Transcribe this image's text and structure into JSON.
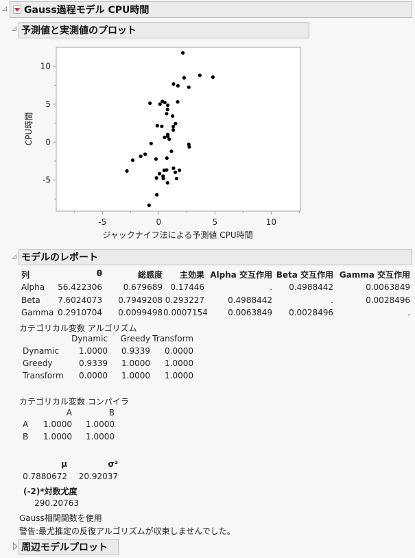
{
  "main_header": {
    "title": "Gauss過程モデル CPU時間",
    "menu_icon": "red-triangle-menu-icon"
  },
  "plot_section": {
    "title": "予測値と実測値のプロット"
  },
  "chart_data": {
    "type": "scatter",
    "title": "予測値と実測値のプロット",
    "xlabel": "ジャックナイフ法による予測値 CPU時間",
    "ylabel": "CPU時間",
    "xlim": [
      -9.1,
      12.6
    ],
    "ylim": [
      -9.1,
      12.5
    ],
    "xticks": [
      -5,
      0,
      5,
      10
    ],
    "xtick_labels": [
      "-5",
      "0",
      "5",
      "10"
    ],
    "x_minor_ticks": [
      -7.5,
      -2.5,
      2.5,
      7.5,
      12.5
    ],
    "yticks": [
      10,
      5,
      0,
      -5
    ],
    "ytick_labels": [
      "10",
      "5",
      "0",
      "-5"
    ],
    "y_minor_ticks": [
      7.5,
      2.5,
      -2.5,
      -7.5
    ],
    "grid": false,
    "marker_color": "#000000",
    "points": [
      [
        2.15,
        11.76
      ],
      [
        2.26,
        8.48
      ],
      [
        3.66,
        8.81
      ],
      [
        4.82,
        8.57
      ],
      [
        1.32,
        7.66
      ],
      [
        1.71,
        7.42
      ],
      [
        2.68,
        7.24
      ],
      [
        -0.77,
        5.13
      ],
      [
        0.12,
        5.01
      ],
      [
        0.33,
        5.37
      ],
      [
        0.55,
        5.22
      ],
      [
        0.81,
        4.85
      ],
      [
        1.69,
        5.31
      ],
      [
        0.79,
        4.31
      ],
      [
        0.71,
        3.74
      ],
      [
        1.24,
        3.44
      ],
      [
        1.5,
        2.44
      ],
      [
        -0.12,
        2.17
      ],
      [
        0.28,
        2.08
      ],
      [
        1.3,
        2.05
      ],
      [
        1.3,
        1.6
      ],
      [
        0.81,
        1.0
      ],
      [
        0.53,
        0.63
      ],
      [
        0.81,
        0.78
      ],
      [
        0.94,
        0.39
      ],
      [
        -0.67,
        -0.18
      ],
      [
        2.68,
        -0.3
      ],
      [
        2.72,
        -0.63
      ],
      [
        1.14,
        -1.21
      ],
      [
        -1.2,
        -1.6
      ],
      [
        -1.59,
        -1.87
      ],
      [
        -2.3,
        -2.38
      ],
      [
        -0.24,
        -2.23
      ],
      [
        0.73,
        -2.11
      ],
      [
        -2.82,
        -3.8
      ],
      [
        0.49,
        -3.71
      ],
      [
        0.71,
        -3.68
      ],
      [
        1.32,
        -3.44
      ],
      [
        1.85,
        -3.71
      ],
      [
        1.48,
        -3.98
      ],
      [
        0.08,
        -4.16
      ],
      [
        0.39,
        -4.49
      ],
      [
        0.41,
        -4.8
      ],
      [
        -0.2,
        -4.73
      ],
      [
        1.59,
        -4.8
      ],
      [
        0.79,
        -5.37
      ],
      [
        -0.16,
        -6.94
      ],
      [
        -0.85,
        -8.33
      ]
    ]
  },
  "report_section": {
    "title": "モデルのレポート",
    "table": {
      "headers": [
        "列",
        "θ",
        "総感度",
        "主効果",
        "Alpha 交互作用",
        "Beta 交互作用",
        "Gamma 交互作用"
      ],
      "rows": [
        [
          "Alpha",
          "56.422306",
          "0.679689",
          "0.17446",
          ".",
          "0.4988442",
          "0.0063849"
        ],
        [
          "Beta",
          "7.6024073",
          "0.7949208",
          "0.293227",
          "0.4988442",
          ".",
          "0.0028496"
        ],
        [
          "Gamma",
          "0.2910704",
          "0.0099498",
          "0.0007154",
          "0.0063849",
          "0.0028496",
          "."
        ]
      ]
    },
    "cat_algorithm": {
      "title": "カテゴリカル変数 アルゴリズム",
      "headers": [
        "",
        "Dynamic",
        "Greedy",
        "Transform"
      ],
      "rows": [
        [
          "Dynamic",
          "1.0000",
          "0.9339",
          "0.0000"
        ],
        [
          "Greedy",
          "0.9339",
          "1.0000",
          "1.0000"
        ],
        [
          "Transform",
          "0.0000",
          "1.0000",
          "1.0000"
        ]
      ]
    },
    "cat_compiler": {
      "title": "カテゴリカル変数 コンパイラ",
      "headers": [
        "",
        "A",
        "B"
      ],
      "rows": [
        [
          "A",
          "1.0000",
          "1.0000"
        ],
        [
          "B",
          "1.0000",
          "1.0000"
        ]
      ]
    },
    "params": {
      "mu_label": "μ",
      "sigma2_label": "σ²",
      "mu_value": "0.7880672",
      "sigma2_value": "20.92037"
    },
    "loglik": {
      "label": "(-2)*対数尤度",
      "value": "290.20763"
    },
    "note": "Gauss相関関数を使用",
    "warning": "警告:最尤推定の反復アルゴリズムが収束しませんでした。"
  },
  "marginal_section": {
    "title": "周辺モデルプロット"
  }
}
